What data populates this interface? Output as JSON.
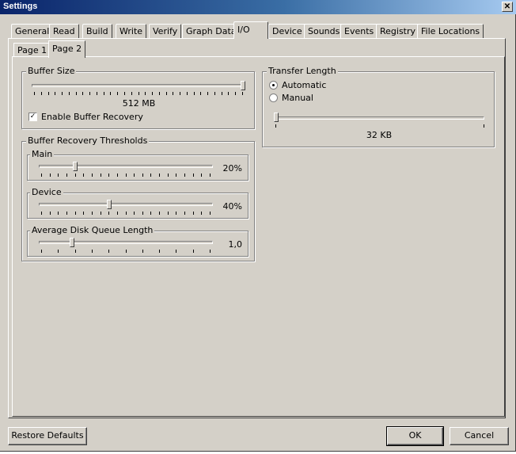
{
  "window": {
    "title": "Settings",
    "close_glyph": "✕"
  },
  "tabs": [
    "General",
    "Read",
    "Build",
    "Write",
    "Verify",
    "Graph Data",
    "I/O",
    "Device",
    "Sounds",
    "Events",
    "Registry",
    "File Locations"
  ],
  "active_tab": "I/O",
  "subtabs": [
    "Page 1",
    "Page 2"
  ],
  "active_subtab": "Page 2",
  "buffer_size": {
    "label": "Buffer Size",
    "value_text": "512 MB",
    "slider_fraction": 1.0,
    "tick_count": 31,
    "enable_recovery": {
      "label": "Enable Buffer Recovery",
      "checked": true
    }
  },
  "thresholds": {
    "label": "Buffer Recovery Thresholds",
    "main": {
      "label": "Main",
      "value_text": "20%",
      "slider_fraction": 0.2,
      "tick_count": 21
    },
    "device": {
      "label": "Device",
      "value_text": "40%",
      "slider_fraction": 0.4,
      "tick_count": 21
    },
    "queue": {
      "label": "Average Disk Queue Length",
      "value_text": "1,0",
      "slider_fraction": 0.18,
      "tick_count": 11
    }
  },
  "transfer_length": {
    "label": "Transfer Length",
    "automatic_label": "Automatic",
    "manual_label": "Manual",
    "mode": "Automatic",
    "value_text": "32 KB",
    "slider_fraction": 0.0
  },
  "buttons": {
    "restore": "Restore Defaults",
    "ok": "OK",
    "cancel": "Cancel"
  }
}
